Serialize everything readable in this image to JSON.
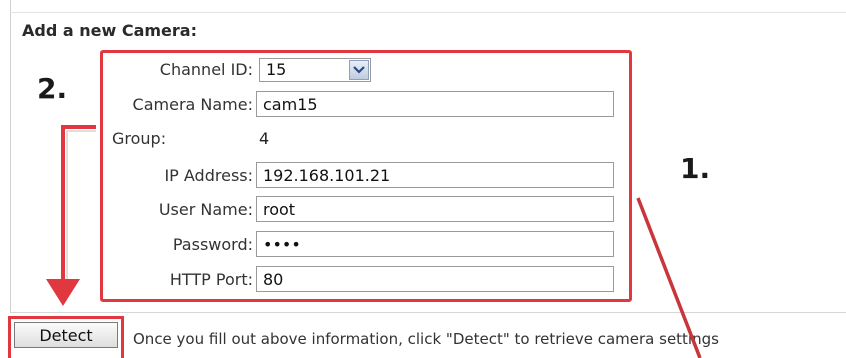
{
  "form": {
    "title": "Add a new Camera:",
    "fields": {
      "channel_id": {
        "label": "Channel ID:",
        "value": "15"
      },
      "camera_name": {
        "label": "Camera Name:",
        "value": "cam15"
      },
      "group": {
        "label": "Group:",
        "value": "4"
      },
      "ip_address": {
        "label": "IP Address:",
        "value": "192.168.101.21"
      },
      "user_name": {
        "label": "User Name:",
        "value": "root"
      },
      "password": {
        "label": "Password:",
        "value": "••••"
      },
      "http_port": {
        "label": "HTTP Port:",
        "value": "80"
      }
    }
  },
  "detect": {
    "label": "Detect",
    "hint": "Once you fill out above information, click \"Detect\" to retrieve camera settings"
  },
  "annotations": {
    "step1": "1.",
    "step2": "2.",
    "highlight_color": "#e0383e"
  },
  "icons": {
    "dropdown": "chevron-down-icon"
  }
}
